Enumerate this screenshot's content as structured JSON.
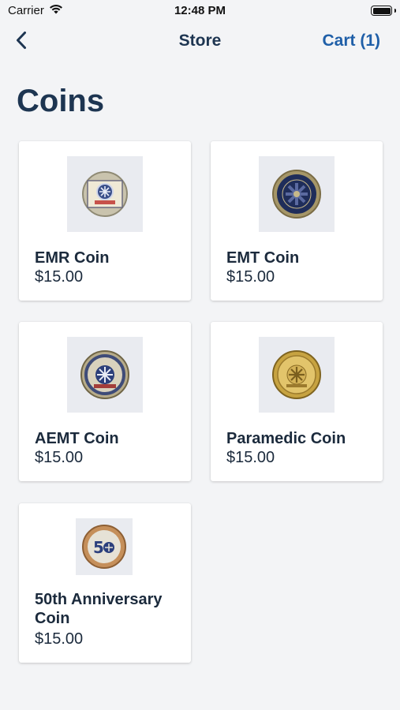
{
  "status": {
    "carrier": "Carrier",
    "time": "12:48 PM"
  },
  "nav": {
    "title": "Store",
    "cart_label": "Cart (1)"
  },
  "page": {
    "title": "Coins"
  },
  "products": [
    {
      "name": "EMR Coin",
      "price": "$15.00",
      "image_alt": "EMR coin photo"
    },
    {
      "name": "EMT Coin",
      "price": "$15.00",
      "image_alt": "EMT coin photo"
    },
    {
      "name": "AEMT Coin",
      "price": "$15.00",
      "image_alt": "AEMT coin photo"
    },
    {
      "name": "Paramedic Coin",
      "price": "$15.00",
      "image_alt": "Paramedic coin photo"
    },
    {
      "name": "50th Anniversary Coin",
      "price": "$15.00",
      "image_alt": "50th anniversary coin photo"
    }
  ],
  "colors": {
    "accent": "#1f5fa8",
    "title": "#1d3551",
    "background": "#f3f4f6"
  }
}
